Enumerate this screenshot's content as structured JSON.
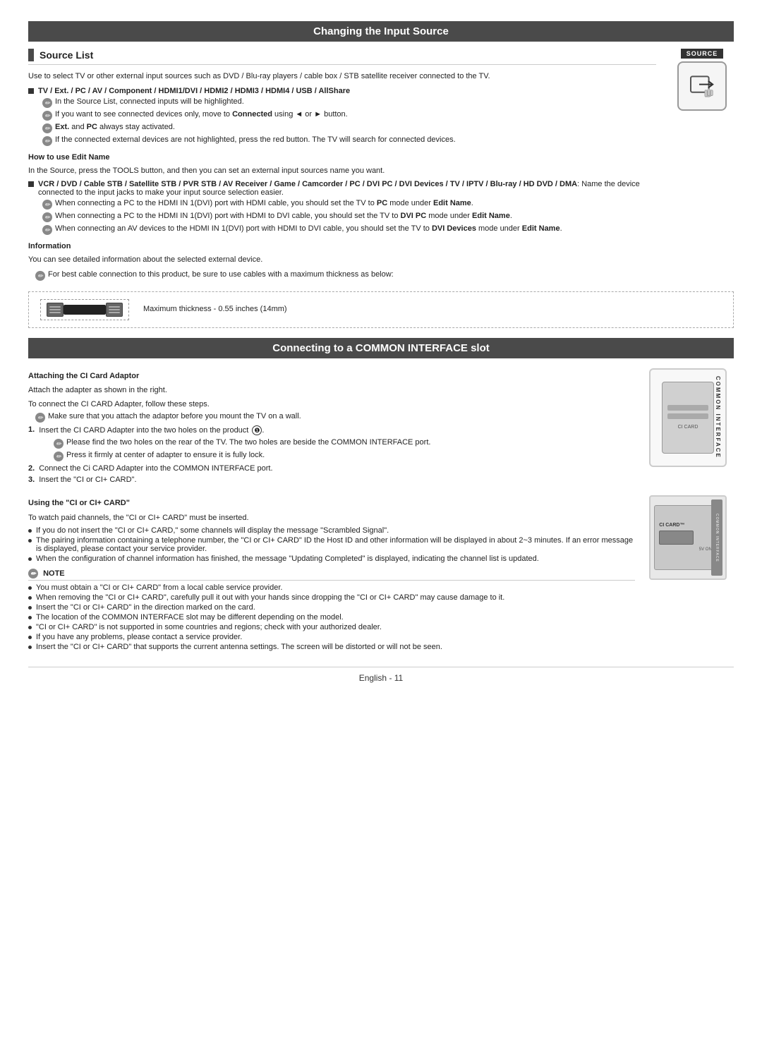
{
  "page1": {
    "header": "Changing the Input Source",
    "source_list": {
      "title": "Source List",
      "description": "Use to select TV or other external input sources such as DVD / Blu-ray players / cable box / STB satellite receiver connected to the TV.",
      "inputs_bold": "TV / Ext. / PC / AV / Component / HDMI1/DVI / HDMI2 / HDMI3 / HDMI4 / USB / AllShare",
      "notes": [
        "In the Source List, connected inputs will be highlighted.",
        "If you want to see connected devices only, move to Connected using ◄ or ► button.",
        "Ext. and PC always stay activated.",
        "If the connected external devices are not highlighted, press the red button. The TV will search for connected devices."
      ],
      "how_to_title": "How to use Edit Name",
      "how_to_desc": "In the Source, press the TOOLS button, and then you can set an external input sources name you want.",
      "vcr_bold": "VCR / DVD / Cable STB / Satellite STB / PVR STB / AV Receiver / Game / Camcorder / PC / DVI PC / DVI Devices / TV / IPTV / Blu-ray / HD DVD / DMA",
      "vcr_suffix": ": Name the device connected to the input jacks to make your input source selection easier.",
      "edit_notes": [
        "When connecting a PC to the HDMI IN 1(DVI) port with HDMI cable, you should set the TV to PC mode under Edit Name.",
        "When connecting a PC to the HDMI IN 1(DVI) port with HDMI to DVI cable, you should set the TV to DVI PC mode under Edit Name.",
        "When connecting an AV devices to the HDMI IN 1(DVI) port with HDMI to DVI cable, you should set the TV to DVI Devices mode under Edit Name."
      ],
      "information_title": "Information",
      "information_desc": "You can see detailed information about the selected external device.",
      "cable_note": "For best cable connection to this product, be sure to use cables with a maximum thickness as below:",
      "max_thickness": "Maximum thickness - 0.55 inches (14mm)"
    }
  },
  "page2": {
    "header": "Connecting to a COMMON INTERFACE slot",
    "attaching": {
      "title": "Attaching the CI Card Adaptor",
      "desc1": "Attach the adapter as shown in the right.",
      "desc2": "To connect the CI CARD Adapter, follow these steps.",
      "note1": "Make sure that you attach the adaptor before you mount the TV on a wall.",
      "steps": [
        "Insert the CI CARD Adapter into the two holes on the product ❶.",
        "Connect the Ci CARD Adapter into the COMMON INTERFACE port.",
        "Insert the \"CI or CI+ CARD\"."
      ],
      "step1_sub_notes": [
        "Please find the two holes on the rear of the TV. The two holes are beside the COMMON INTERFACE port.",
        "Press it firmly at center of adapter to ensure it is fully lock."
      ],
      "ci_labels": [
        "COMMON",
        "INTERFACE"
      ]
    },
    "using": {
      "title": "Using the \"CI or CI+ CARD\"",
      "desc": "To watch paid channels, the \"CI or CI+ CARD\" must be inserted.",
      "bullets": [
        "If you do not insert the \"CI or CI+ CARD,\" some channels will display the message \"Scrambled Signal\".",
        "The pairing information containing a telephone number, the \"CI or CI+ CARD\" ID the Host ID and other information will be displayed in about 2~3 minutes. If an error message is displayed, please contact your service provider.",
        "When the configuration of channel information has finished, the message \"Updating Completed\" is displayed, indicating the channel list is updated."
      ],
      "note_title": "NOTE",
      "notes": [
        "You must obtain a \"CI or CI+ CARD\" from a local cable service provider.",
        "When removing the \"CI or CI+ CARD\", carefully pull it out with your hands since dropping the \"CI or CI+ CARD\" may cause damage to it.",
        "Insert the \"CI or CI+ CARD\" in the direction marked on the card.",
        "The location of the COMMON INTERFACE slot may be different depending on the model.",
        "\"CI or CI+ CARD\" is not supported in some countries and regions; check with your authorized dealer.",
        "If you have any problems, please contact a service provider.",
        "Insert the \"CI or CI+ CARD\" that supports the current antenna settings. The screen will be distorted or will not be seen."
      ]
    }
  },
  "footer": {
    "label": "English - 11"
  },
  "source_button_label": "SOURCE",
  "ext_bold": "Ext.",
  "pc_bold": "PC",
  "connected_bold": "Connected",
  "edit_name_labels": [
    "PC",
    "Edit Name",
    "DVI PC",
    "Edit Name",
    "DVI Devices",
    "Edit Name"
  ]
}
